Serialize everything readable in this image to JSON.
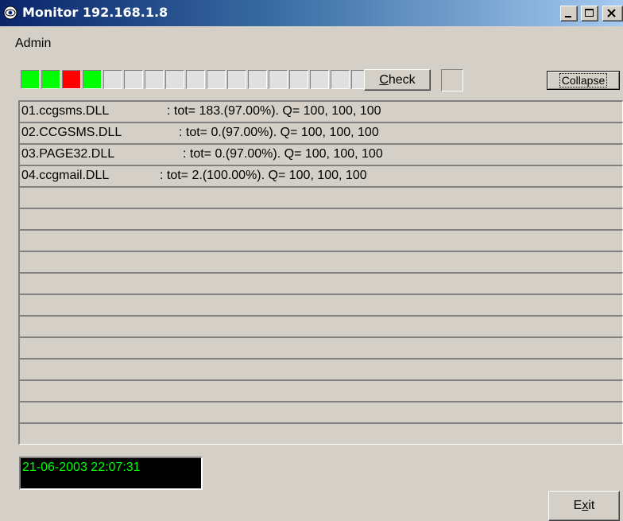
{
  "window": {
    "title": "Monitor 192.168.1.8",
    "icon": "eye-icon",
    "controls": [
      "minimize-icon",
      "maximize-icon",
      "close-icon"
    ]
  },
  "menu": {
    "items": [
      "Admin"
    ]
  },
  "toolbar": {
    "indicators": [
      "green",
      "green",
      "red",
      "green",
      "empty",
      "empty",
      "empty",
      "empty",
      "empty",
      "empty",
      "empty",
      "empty",
      "empty",
      "empty",
      "empty",
      "empty",
      "empty"
    ],
    "indicator_colors": {
      "green": "#00ff00",
      "red": "#ff0000",
      "empty": "#e0e0e0"
    },
    "check_button": {
      "underlined": "C",
      "rest": "heck"
    },
    "collapse_label": "Collapse"
  },
  "list": {
    "rows": [
      {
        "name": "01.ccgsms.DLL",
        "stats": ": tot= 183.(97.00%). Q= 100, 100, 100"
      },
      {
        "name": "02.CCGSMS.DLL",
        "stats": ": tot= 0.(97.00%). Q= 100, 100, 100"
      },
      {
        "name": "03.PAGE32.DLL",
        "stats": ": tot= 0.(97.00%). Q= 100, 100, 100"
      },
      {
        "name": "04.ccgmail.DLL",
        "stats": ": tot= 2.(100.00%). Q= 100, 100, 100"
      },
      {
        "name": "",
        "stats": ""
      },
      {
        "name": "",
        "stats": ""
      },
      {
        "name": "",
        "stats": ""
      },
      {
        "name": "",
        "stats": ""
      },
      {
        "name": "",
        "stats": ""
      },
      {
        "name": "",
        "stats": ""
      },
      {
        "name": "",
        "stats": ""
      },
      {
        "name": "",
        "stats": ""
      },
      {
        "name": "",
        "stats": ""
      },
      {
        "name": "",
        "stats": ""
      },
      {
        "name": "",
        "stats": ""
      },
      {
        "name": "",
        "stats": ""
      }
    ]
  },
  "status": {
    "datetime": "21-06-2003 22:07:31",
    "datetime_color": "#00ff00"
  },
  "footer": {
    "exit_button": {
      "underlined": "x",
      "before": "E",
      "after": "it"
    }
  }
}
